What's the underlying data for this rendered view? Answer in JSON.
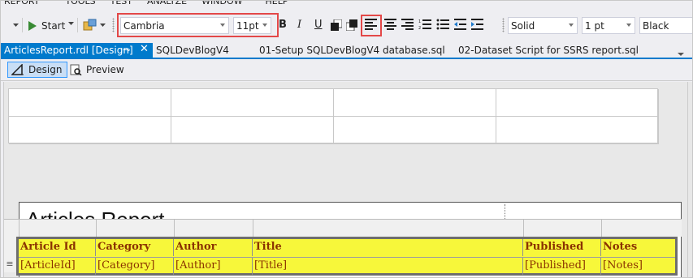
{
  "menu": [
    "REPORT",
    "TOOLS",
    "TEST",
    "ANALYZE",
    "WINDOW",
    "HELP"
  ],
  "toolbar": {
    "start_label": "Start",
    "font_family": "Cambria",
    "font_size": "11pt",
    "bold": "B",
    "italic": "I",
    "underline": "U",
    "border_style": "Solid",
    "border_width": "1 pt",
    "border_color": "Black"
  },
  "tabs": {
    "active": "ArticlesReport.rdl [Design]",
    "others": [
      "SQLDevBlogV4",
      "01-Setup SQLDevBlogV4 database.sql",
      "02-Dataset Script for SSRS report.sql"
    ]
  },
  "view_tabs": {
    "design": "Design",
    "preview": "Preview"
  },
  "report": {
    "title": "Articles Report",
    "headers": [
      "Article Id",
      "Category",
      "Author",
      "Title",
      "Published",
      "Notes"
    ],
    "details": [
      "[ArticleId]",
      "[Category]",
      "[Author]",
      "[Title]",
      "[Published]",
      "[Notes]"
    ]
  },
  "colors": {
    "accent": "#007acc",
    "highlight_border": "#e34848",
    "tablix_fill": "#f7f73a",
    "cell_text": "#8a3200"
  }
}
